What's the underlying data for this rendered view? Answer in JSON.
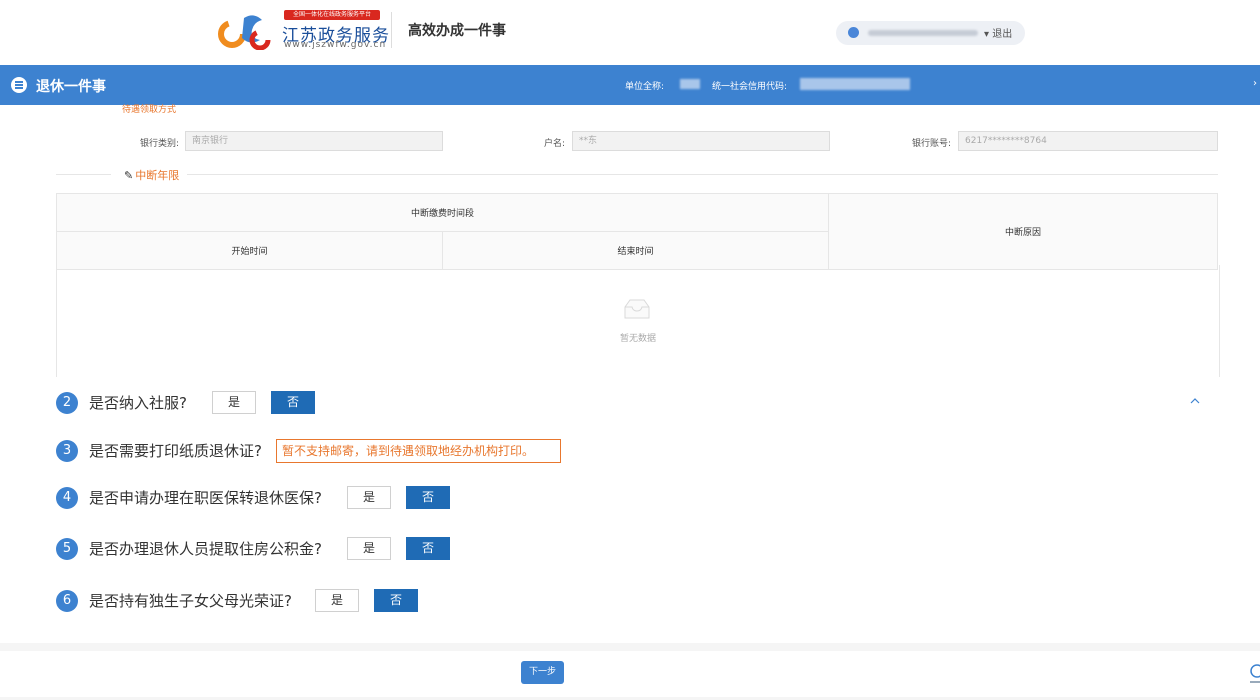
{
  "header": {
    "badge": "全国一体化在线政务服务平台",
    "brand": "江苏政务服务",
    "url": "www.jszwfw.gov.cn",
    "app_title": "高效办成一件事",
    "logout": "▾ 退出"
  },
  "bar": {
    "title": "退休一件事",
    "unit_label": "单位全称:",
    "credit_label": "统一社会信用代码:"
  },
  "bank": {
    "section_cut": "待遇领取方式",
    "type_label": "银行类别:",
    "type_value": "南京银行",
    "name_label": "户名:",
    "name_value": "**东",
    "account_label": "银行账号:",
    "account_value": "6217********8764"
  },
  "interrupt": {
    "title": "中断年限",
    "period_header": "中断缴费时间段",
    "start_header": "开始时间",
    "end_header": "结束时间",
    "reason_header": "中断原因",
    "empty_text": "暂无数据"
  },
  "questions": {
    "q2": {
      "num": "2",
      "text": "是否纳入社服?",
      "yes": "是",
      "no": "否"
    },
    "q3": {
      "num": "3",
      "text": "是否需要打印纸质退休证?",
      "notice": "暂不支持邮寄，请到待遇领取地经办机构打印。"
    },
    "q4": {
      "num": "4",
      "text": "是否申请办理在职医保转退休医保?",
      "yes": "是",
      "no": "否"
    },
    "q5": {
      "num": "5",
      "text": "是否办理退休人员提取住房公积金?",
      "yes": "是",
      "no": "否"
    },
    "q6": {
      "num": "6",
      "text": "是否持有独生子女父母光荣证?",
      "yes": "是",
      "no": "否"
    }
  },
  "footer": {
    "next": "下一步"
  },
  "colors": {
    "primary": "#3d82d0",
    "selected": "#1f6bb5",
    "accent_orange": "#e8772e",
    "brand_red": "#d9281f"
  },
  "icons": [
    "jszw-logo-icon",
    "user-icon",
    "list-icon",
    "pencil-icon",
    "inbox-icon",
    "chevron-up-icon",
    "assistant-icon"
  ]
}
